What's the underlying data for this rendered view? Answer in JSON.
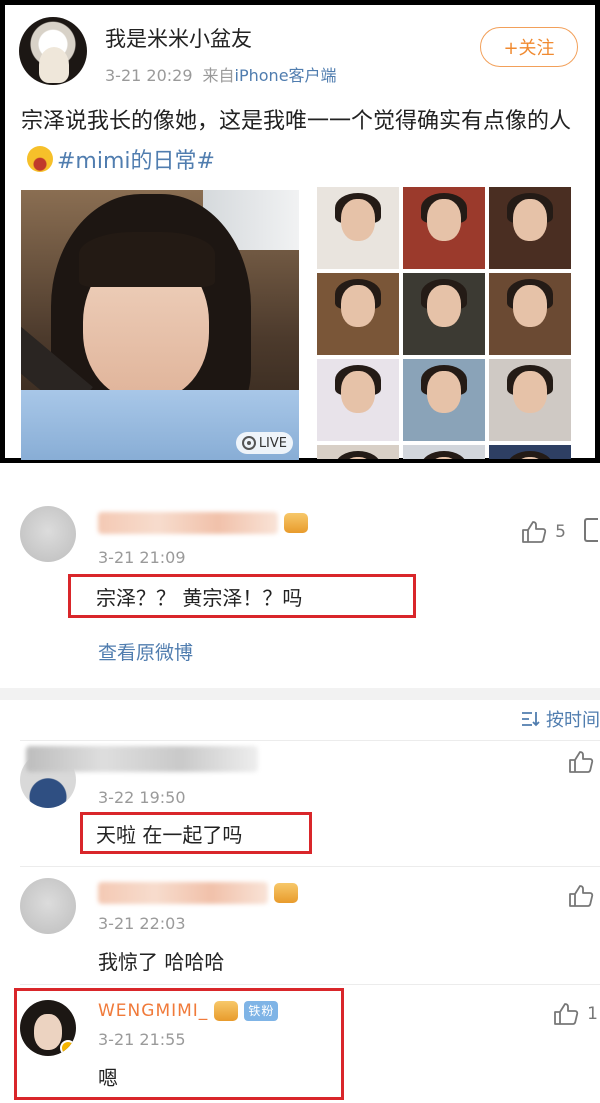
{
  "post": {
    "username": "我是米米小盆友",
    "time": "3-21 20:29",
    "source_prefix": "来自",
    "source_device": "iPhone客户端",
    "follow_label": "+关注",
    "text_main": "宗泽说我长的像她，这是我唯一一个觉得确实有点像的人",
    "topic": "#mimi的日常#",
    "live_label": "LIVE"
  },
  "comments": [
    {
      "time": "3-21 21:09",
      "text": "宗泽？？ 黄宗泽！？吗",
      "likes": "5",
      "view_original": "查看原微博"
    },
    {
      "time": "3-22 19:50",
      "text": "天啦 在一起了吗"
    },
    {
      "time": "3-21 22:03",
      "text": "我惊了 哈哈哈"
    },
    {
      "name": "WENGMIMI_",
      "badge": "铁粉",
      "time": "3-21 21:55",
      "text": "嗯",
      "likes": "1"
    }
  ],
  "sort_label": "按时间",
  "colors": {
    "accent_orange": "#f08a30",
    "link_blue": "#507daf",
    "highlight_red": "#d9262a"
  }
}
